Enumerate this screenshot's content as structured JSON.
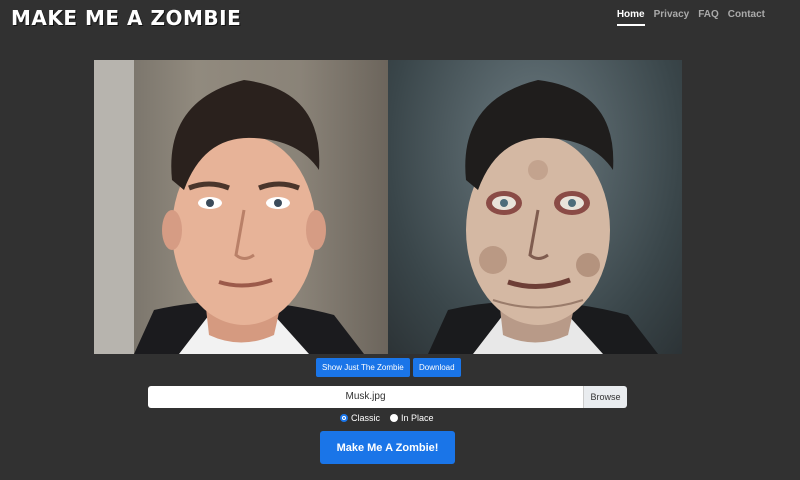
{
  "brand": {
    "title": "MAKE ME A ZOMBIE"
  },
  "nav": {
    "items": [
      "Home",
      "Privacy",
      "FAQ",
      "Contact"
    ],
    "active": "Home"
  },
  "images": {
    "original_alt": "Original photo",
    "zombie_alt": "Zombie photo"
  },
  "actions": {
    "show_zombie": "Show Just The Zombie",
    "download": "Download"
  },
  "upload": {
    "file_name": "Musk.jpg",
    "browse_label": "Browse"
  },
  "mode": {
    "options": [
      "Classic",
      "In Place"
    ],
    "selected": "Classic"
  },
  "cta": {
    "label": "Make Me A Zombie!"
  },
  "colors": {
    "background": "#313131",
    "accent": "#1a75e8"
  }
}
